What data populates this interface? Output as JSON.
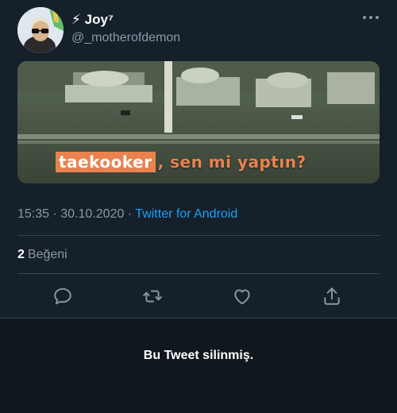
{
  "tweet": {
    "display_name": "⚡ Joy⁷",
    "handle": "@_motherofdemon",
    "media_caption_highlight": "taekooker",
    "media_caption_rest": ", sen mi yaptın?",
    "time": "15:35",
    "date": "30.10.2020",
    "separator": "·",
    "source": "Twitter for Android",
    "likes_count": "2",
    "likes_label": "Beğeni"
  },
  "deleted_notice": "Bu Tweet silinmiş.",
  "icons": {
    "more": "more-horizontal-icon",
    "reply": "reply-icon",
    "retweet": "retweet-icon",
    "like": "heart-icon",
    "share": "share-icon"
  },
  "colors": {
    "background": "#15202b",
    "accent": "#1da1f2",
    "secondary_text": "#8899a6",
    "caption_orange": "#e8834f"
  }
}
